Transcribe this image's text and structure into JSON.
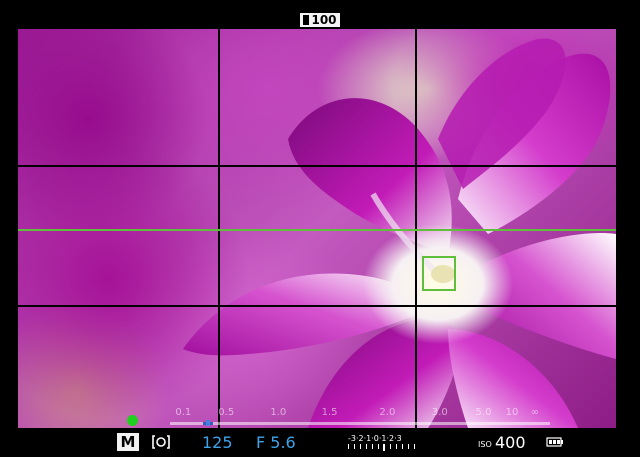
{
  "top": {
    "shots_remaining": "100"
  },
  "distance_scale": {
    "ticks": [
      {
        "label": "0.1",
        "pos": 0.035
      },
      {
        "label": "0.5",
        "pos": 0.148
      },
      {
        "label": "1.0",
        "pos": 0.285
      },
      {
        "label": "1.5",
        "pos": 0.42
      },
      {
        "label": "2.0",
        "pos": 0.572
      },
      {
        "label": "3.0",
        "pos": 0.71
      },
      {
        "label": "5.0",
        "pos": 0.825
      },
      {
        "label": "10",
        "pos": 0.9
      },
      {
        "label": "∞",
        "pos": 0.96
      }
    ]
  },
  "status": {
    "mode": "M",
    "metering_icon": "center-weighted-metering-icon",
    "shutter": "125",
    "aperture": "F 5.6",
    "exposure_scale": "-3·2·1·0·1·2·3",
    "iso_label": "ISO",
    "iso_value": "400",
    "battery_icon": "battery-full-icon"
  },
  "colors": {
    "accent_blue": "#3ea3e8",
    "grid_green": "#5fbf3a",
    "indicator_green": "#1fd01f"
  }
}
